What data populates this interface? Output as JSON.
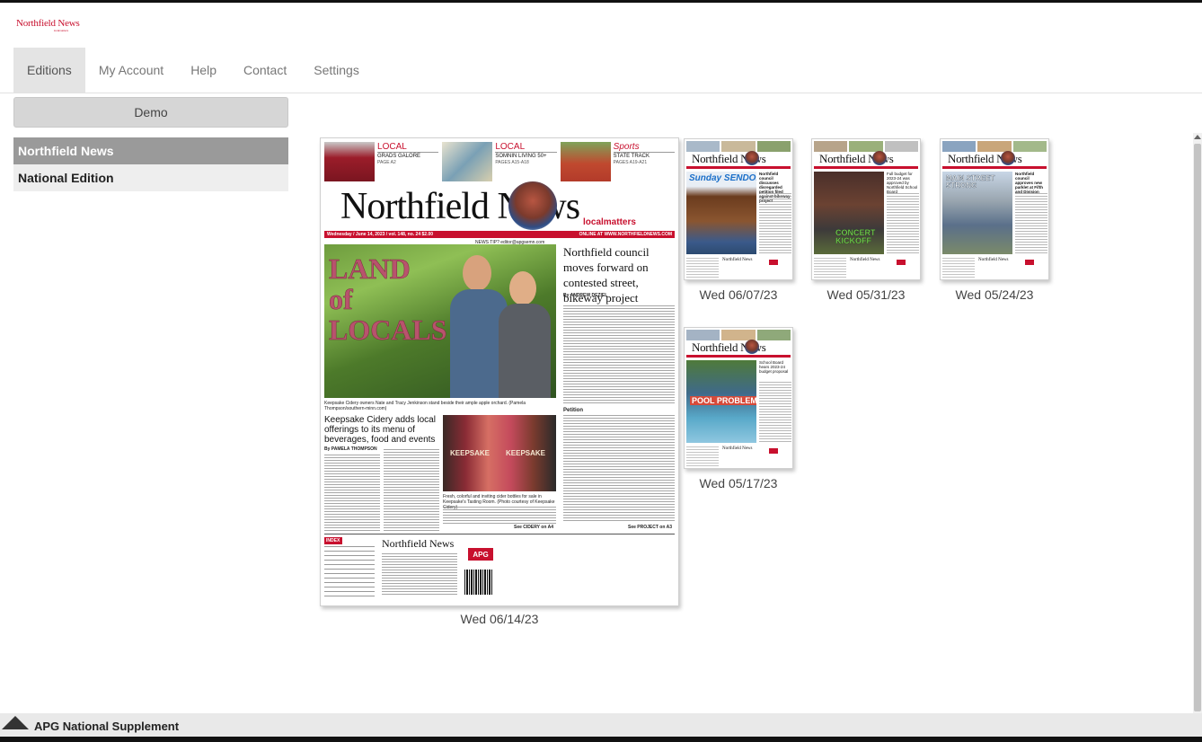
{
  "app": {
    "logo_text": "Northfield News",
    "logo_sub": "localmatters"
  },
  "nav": {
    "tabs": [
      "Editions",
      "My Account",
      "Help",
      "Contact",
      "Settings"
    ],
    "active": "Editions"
  },
  "sidebar": {
    "demo_label": "Demo",
    "items": [
      "Northfield News",
      "National Edition"
    ],
    "active": "Northfield News"
  },
  "editions": [
    {
      "caption": "Wed 06/14/23",
      "masthead": "Northfield News",
      "masthead_sub": "localmatters",
      "teasers": [
        {
          "kicker": "LOCAL",
          "text": "GRADS GALORE",
          "ref": "PAGE A2"
        },
        {
          "kicker": "LOCAL",
          "text": "SOMNIN LIVING 50+",
          "ref": "PAGES A15-A18"
        },
        {
          "kicker": "Sports",
          "text": "STATE TRACK",
          "ref": "PAGES A19-A21"
        }
      ],
      "dateline_left": "Wednesday / June 14, 2023 / vol. 148, no. 24  $2.00",
      "dateline_right": "ONLINE AT WWW.NORTHFIELDNEWS.COM",
      "tipline": "NEWS TIP? editor@apgsemn.com",
      "lead_overlay": "LAND of LOCALS",
      "lead_caption": "Keepsake Cidery owners Nate and Tracy Jenkinson stand beside their ample apple orchard. (Pamela Thompson/southern-minn.com)",
      "headline": "Northfield council moves forward on contested street, bikeway project",
      "headline_byline": "By ANDREW DEZIEL",
      "section_head": "Petition",
      "subhead": "Keepsake Cidery adds local offerings to its menu of beverages, food and events",
      "subhead_byline": "By PAMELA THOMPSON",
      "bottle_label": "KEEPSAKE",
      "photo2_caption": "Fresh, colorful and inviting cider bottles for sale in Keepsake's Tasting Room. (Photo courtesy of Keepsake Cidery)",
      "see_cidery": "See CIDERY on A4",
      "see_project": "See PROJECT on A3",
      "index_title": "INDEX",
      "footer_masthead": "Northfield News",
      "apg": "APG"
    },
    {
      "caption": "Wed 06/07/23",
      "masthead": "Northfield News",
      "overlay": "Sunday SENDOFF",
      "headline": "Northfield council discusses disregarded petition filed against bikeway project"
    },
    {
      "caption": "Wed 05/31/23",
      "masthead": "Northfield News",
      "overlay": "CONCERT KICKOFF",
      "headline": "Full budget for 2023-24 was approved by Northfield School Board"
    },
    {
      "caption": "Wed 05/24/23",
      "masthead": "Northfield News",
      "overlay": "MAIN STREET STRONG",
      "headline": "Northfield council approves new parklet at Fifth and Division"
    },
    {
      "caption": "Wed 05/17/23",
      "masthead": "Northfield News",
      "overlay": "POOL PROBLEM",
      "headline": "School Board hears 2023-24 budget proposal"
    }
  ],
  "footer": {
    "label": "APG National Supplement"
  },
  "colors": {
    "brand_red": "#c8102e",
    "active_sidebar": "#9a9a9a",
    "tab_active_bg": "#e4e4e4"
  }
}
